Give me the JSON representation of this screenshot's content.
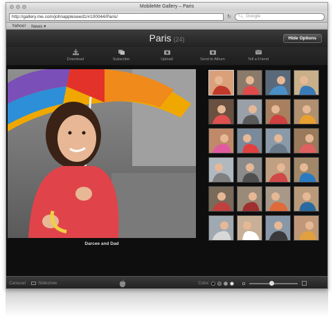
{
  "window": {
    "title": "MobileMe Gallery – Paris"
  },
  "urlbar": {
    "url": "http://gallery.me.com/johnappleseed1/#100044/Paris/",
    "search_placeholder": "Google"
  },
  "bookmarks": [
    "Yahoo!",
    "News ▾"
  ],
  "header": {
    "title": "Paris",
    "count": "(24)",
    "hide_options": "Hide Options"
  },
  "toolbar": [
    {
      "label": "Download",
      "icon": "download-icon"
    },
    {
      "label": "Subscribe",
      "icon": "subscribe-icon"
    },
    {
      "label": "Upload",
      "icon": "upload-icon"
    },
    {
      "label": "Send to Album",
      "icon": "send-to-album-icon"
    },
    {
      "label": "Tell a Friend",
      "icon": "tell-a-friend-icon"
    }
  ],
  "photo": {
    "caption": "Darcee and Dad"
  },
  "bottombar": {
    "carousel": "Carousel",
    "slideshow": "Slideshow",
    "color_label": "Color:"
  },
  "thumbnails_count": 24,
  "selected_index": 0,
  "zoom_level": 0.45,
  "colors": {
    "accent": "#f0a000",
    "background": "#0e0e0e"
  }
}
